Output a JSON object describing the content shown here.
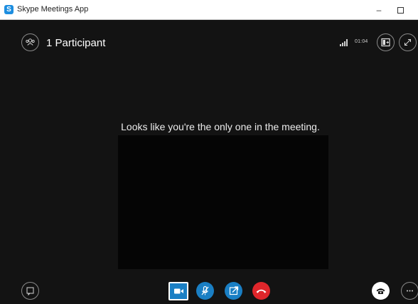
{
  "window": {
    "title": "Skype Meetings App",
    "app_icon_letter": "S",
    "minimize_glyph": "–",
    "close_glyph": "×"
  },
  "header": {
    "participant_count_label": "1 Participant",
    "call_duration": "01:04",
    "icons": {
      "participants": "people-icon",
      "signal": "signal-strength-icon",
      "layout": "layout-icon",
      "fullscreen": "expand-icon"
    }
  },
  "stage": {
    "message": "Looks like you're the only one in the meeting."
  },
  "controls": {
    "left": {
      "icon": "chat-icon"
    },
    "center": [
      {
        "name": "video",
        "icon": "video-camera-icon"
      },
      {
        "name": "mute",
        "icon": "microphone-muted-icon"
      },
      {
        "name": "share",
        "icon": "present-share-icon"
      },
      {
        "name": "hang-up",
        "icon": "hang-up-icon"
      }
    ],
    "right": [
      {
        "name": "call-controls",
        "icon": "phone-icon"
      },
      {
        "name": "more",
        "icon": "more-icon"
      }
    ]
  },
  "colors": {
    "background": "#131313",
    "accent_blue": "#1a7fc4",
    "hangup_red": "#e0262b",
    "titlebar": "#ffffff"
  }
}
